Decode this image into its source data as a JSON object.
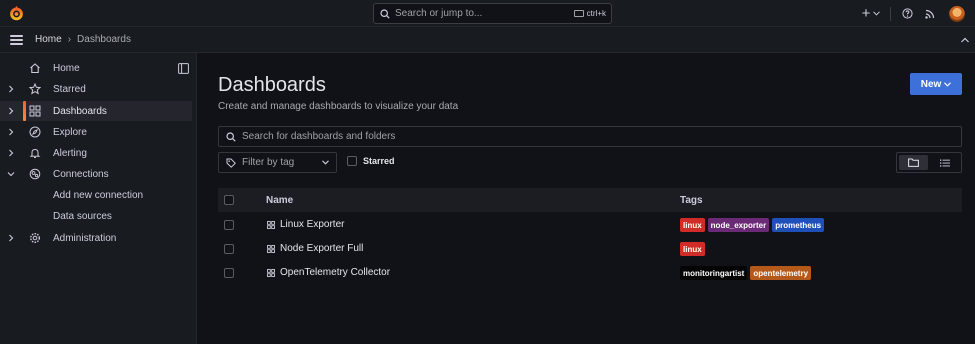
{
  "topbar": {
    "search_placeholder": "Search or jump to...",
    "shortcut": "ctrl+k",
    "plus_label": "+"
  },
  "breadcrumb": {
    "home": "Home",
    "current": "Dashboards"
  },
  "sidebar": {
    "items": [
      {
        "label": "Home"
      },
      {
        "label": "Starred"
      },
      {
        "label": "Dashboards"
      },
      {
        "label": "Explore"
      },
      {
        "label": "Alerting"
      },
      {
        "label": "Connections"
      },
      {
        "label": "Add new connection"
      },
      {
        "label": "Data sources"
      },
      {
        "label": "Administration"
      }
    ]
  },
  "main": {
    "title": "Dashboards",
    "subtitle": "Create and manage dashboards to visualize your data",
    "new_button": "New",
    "search_placeholder": "Search for dashboards and folders",
    "filter_placeholder": "Filter by tag",
    "starred_label": "Starred"
  },
  "table": {
    "headers": {
      "name": "Name",
      "tags": "Tags"
    },
    "rows": [
      {
        "name": "Linux Exporter",
        "tags": [
          {
            "label": "linux",
            "color": "#d22c28"
          },
          {
            "label": "node_exporter",
            "color": "#6b2a75"
          },
          {
            "label": "prometheus",
            "color": "#1f4fb8"
          }
        ]
      },
      {
        "name": "Node Exporter Full",
        "tags": [
          {
            "label": "linux",
            "color": "#d22c28"
          }
        ]
      },
      {
        "name": "OpenTelemetry Collector",
        "tags": [
          {
            "label": "monitoringartist",
            "color": "#050505"
          },
          {
            "label": "opentelemetry",
            "color": "#b5591a"
          }
        ]
      }
    ]
  },
  "colors": {
    "accent": "#3d71d9",
    "active_indicator": "#f55f3e",
    "background": "#111217",
    "panel": "#181b1f"
  }
}
